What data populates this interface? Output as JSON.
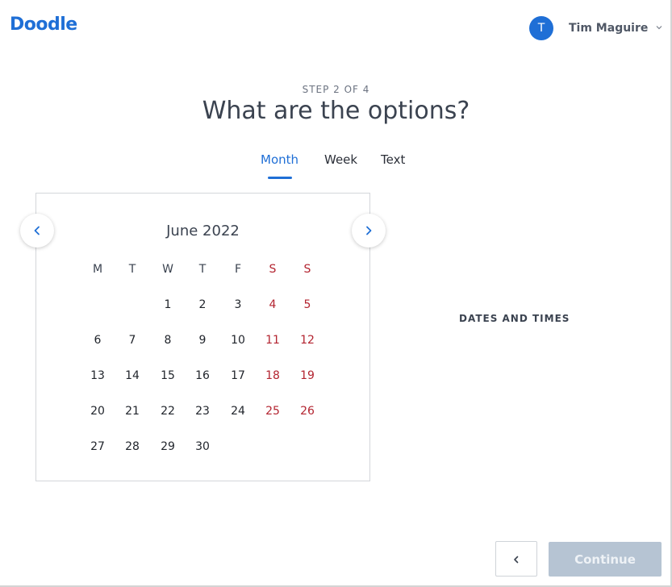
{
  "header": {
    "logo": "Doodle",
    "user": {
      "initial": "T",
      "name": "Tim Maguire"
    }
  },
  "page": {
    "step": "STEP 2 OF 4",
    "title": "What are the options?"
  },
  "tabs": [
    {
      "label": "Month",
      "active": true
    },
    {
      "label": "Week",
      "active": false
    },
    {
      "label": "Text",
      "active": false
    }
  ],
  "calendar": {
    "month_label": "June 2022",
    "weekdays": [
      "M",
      "T",
      "W",
      "T",
      "F",
      "S",
      "S"
    ],
    "weeks": [
      [
        "",
        "",
        "1",
        "2",
        "3",
        "4",
        "5"
      ],
      [
        "6",
        "7",
        "8",
        "9",
        "10",
        "11",
        "12"
      ],
      [
        "13",
        "14",
        "15",
        "16",
        "17",
        "18",
        "19"
      ],
      [
        "20",
        "21",
        "22",
        "23",
        "24",
        "25",
        "26"
      ],
      [
        "27",
        "28",
        "29",
        "30",
        "",
        "",
        ""
      ]
    ]
  },
  "side_panel": {
    "heading": "DATES AND TIMES"
  },
  "footer": {
    "continue_label": "Continue"
  },
  "colors": {
    "accent": "#1f6fd6",
    "weekend": "#b32430",
    "continue_disabled": "#b6c4d3"
  },
  "icons": {
    "prev_month": "chevron-left-icon",
    "next_month": "chevron-right-icon",
    "user_menu": "chevron-down-icon",
    "back": "chevron-left-icon"
  }
}
